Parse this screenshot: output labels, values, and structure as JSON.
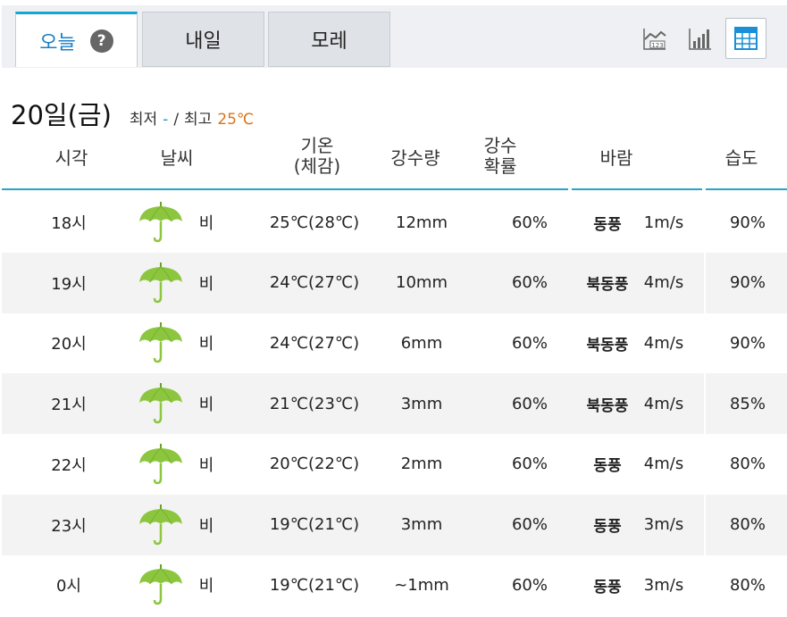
{
  "tabs": {
    "today": "오늘",
    "tomorrow": "내일",
    "day_after": "모레",
    "help": "?"
  },
  "view_buttons": {
    "line_chart_icon": "line-chart-icon",
    "bar_chart_icon": "bar-chart-icon",
    "table_icon": "table-icon",
    "line_chart_badge": "123",
    "active": "table"
  },
  "date": {
    "title": "20일(금)",
    "min_label": "최저",
    "min_value": "-",
    "separator": "/",
    "max_label": "최고",
    "max_value": "25℃"
  },
  "columns": {
    "time": "시각",
    "weather": "날씨",
    "temp_line1": "기온",
    "temp_line2": "(체감)",
    "precip": "강수량",
    "prob_line1": "강수",
    "prob_line2": "확률",
    "wind": "바람",
    "humidity": "습도"
  },
  "colors": {
    "accent": "#19a3cf",
    "max_temp": "#d9731a",
    "min_temp": "#1a95c8",
    "umbrella": "#8cc63f"
  },
  "rows": [
    {
      "time": "18시",
      "icon": "umbrella-icon",
      "weather": "비",
      "temp": "25℃(28℃)",
      "precip": "12mm",
      "prob": "60%",
      "wind_dir": "동풍",
      "wind_speed": "1m/s",
      "humidity": "90%"
    },
    {
      "time": "19시",
      "icon": "umbrella-icon",
      "weather": "비",
      "temp": "24℃(27℃)",
      "precip": "10mm",
      "prob": "60%",
      "wind_dir": "북동풍",
      "wind_speed": "4m/s",
      "humidity": "90%"
    },
    {
      "time": "20시",
      "icon": "umbrella-icon",
      "weather": "비",
      "temp": "24℃(27℃)",
      "precip": "6mm",
      "prob": "60%",
      "wind_dir": "북동풍",
      "wind_speed": "4m/s",
      "humidity": "90%"
    },
    {
      "time": "21시",
      "icon": "umbrella-icon",
      "weather": "비",
      "temp": "21℃(23℃)",
      "precip": "3mm",
      "prob": "60%",
      "wind_dir": "북동풍",
      "wind_speed": "4m/s",
      "humidity": "85%"
    },
    {
      "time": "22시",
      "icon": "umbrella-icon",
      "weather": "비",
      "temp": "20℃(22℃)",
      "precip": "2mm",
      "prob": "60%",
      "wind_dir": "동풍",
      "wind_speed": "4m/s",
      "humidity": "80%"
    },
    {
      "time": "23시",
      "icon": "umbrella-icon",
      "weather": "비",
      "temp": "19℃(21℃)",
      "precip": "3mm",
      "prob": "60%",
      "wind_dir": "동풍",
      "wind_speed": "3m/s",
      "humidity": "80%"
    },
    {
      "time": "0시",
      "icon": "umbrella-icon",
      "weather": "비",
      "temp": "19℃(21℃)",
      "precip": "~1mm",
      "prob": "60%",
      "wind_dir": "동풍",
      "wind_speed": "3m/s",
      "humidity": "80%"
    }
  ]
}
